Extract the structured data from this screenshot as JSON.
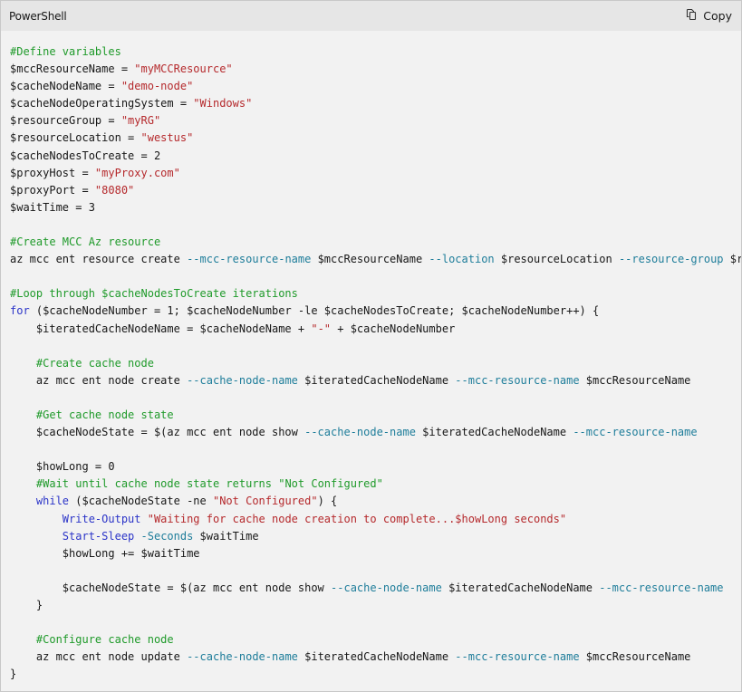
{
  "header": {
    "language": "PowerShell",
    "copy_label": "Copy",
    "copy_icon": "copy-icon"
  },
  "colors": {
    "comment": "#1f9a2a",
    "string": "#b5292c",
    "parameter": "#1e7d9a",
    "keyword": "#2b34c8",
    "text": "#171717",
    "background": "#f2f2f2",
    "header_background": "#e6e6e6"
  },
  "code": {
    "lines": [
      [
        {
          "t": "c",
          "v": "#Define variables"
        }
      ],
      [
        {
          "t": "n",
          "v": "$mccResourceName = "
        },
        {
          "t": "s",
          "v": "\"myMCCResource\""
        }
      ],
      [
        {
          "t": "n",
          "v": "$cacheNodeName = "
        },
        {
          "t": "s",
          "v": "\"demo-node\""
        }
      ],
      [
        {
          "t": "n",
          "v": "$cacheNodeOperatingSystem = "
        },
        {
          "t": "s",
          "v": "\"Windows\""
        }
      ],
      [
        {
          "t": "n",
          "v": "$resourceGroup = "
        },
        {
          "t": "s",
          "v": "\"myRG\""
        }
      ],
      [
        {
          "t": "n",
          "v": "$resourceLocation = "
        },
        {
          "t": "s",
          "v": "\"westus\""
        }
      ],
      [
        {
          "t": "n",
          "v": "$cacheNodesToCreate = 2"
        }
      ],
      [
        {
          "t": "n",
          "v": "$proxyHost = "
        },
        {
          "t": "s",
          "v": "\"myProxy.com\""
        }
      ],
      [
        {
          "t": "n",
          "v": "$proxyPort = "
        },
        {
          "t": "s",
          "v": "\"8080\""
        }
      ],
      [
        {
          "t": "n",
          "v": "$waitTime = 3"
        }
      ],
      [],
      [
        {
          "t": "c",
          "v": "#Create MCC Az resource"
        }
      ],
      [
        {
          "t": "n",
          "v": "az mcc ent resource create "
        },
        {
          "t": "p",
          "v": "--mcc-resource-name"
        },
        {
          "t": "n",
          "v": " $mccResourceName "
        },
        {
          "t": "p",
          "v": "--location"
        },
        {
          "t": "n",
          "v": " $resourceLocation "
        },
        {
          "t": "p",
          "v": "--resource-group"
        },
        {
          "t": "n",
          "v": " $resourceGroup"
        }
      ],
      [],
      [
        {
          "t": "c",
          "v": "#Loop through $cacheNodesToCreate iterations"
        }
      ],
      [
        {
          "t": "k",
          "v": "for"
        },
        {
          "t": "n",
          "v": " ($cacheNodeNumber = 1; $cacheNodeNumber -le $cacheNodesToCreate; $cacheNodeNumber++) {"
        }
      ],
      [
        {
          "t": "n",
          "v": "    $iteratedCacheNodeName = $cacheNodeName + "
        },
        {
          "t": "s",
          "v": "\"-\""
        },
        {
          "t": "n",
          "v": " + $cacheNodeNumber"
        }
      ],
      [],
      [
        {
          "t": "n",
          "v": "    "
        },
        {
          "t": "c",
          "v": "#Create cache node"
        }
      ],
      [
        {
          "t": "n",
          "v": "    az mcc ent node create "
        },
        {
          "t": "p",
          "v": "--cache-node-name"
        },
        {
          "t": "n",
          "v": " $iteratedCacheNodeName "
        },
        {
          "t": "p",
          "v": "--mcc-resource-name"
        },
        {
          "t": "n",
          "v": " $mccResourceName"
        }
      ],
      [],
      [
        {
          "t": "n",
          "v": "    "
        },
        {
          "t": "c",
          "v": "#Get cache node state"
        }
      ],
      [
        {
          "t": "n",
          "v": "    $cacheNodeState = $(az mcc ent node show "
        },
        {
          "t": "p",
          "v": "--cache-node-name"
        },
        {
          "t": "n",
          "v": " $iteratedCacheNodeName "
        },
        {
          "t": "p",
          "v": "--mcc-resource-name"
        }
      ],
      [],
      [
        {
          "t": "n",
          "v": "    $howLong = 0"
        }
      ],
      [
        {
          "t": "n",
          "v": "    "
        },
        {
          "t": "c",
          "v": "#Wait until cache node state returns \"Not Configured\""
        }
      ],
      [
        {
          "t": "n",
          "v": "    "
        },
        {
          "t": "k",
          "v": "while"
        },
        {
          "t": "n",
          "v": " ($cacheNodeState -ne "
        },
        {
          "t": "s",
          "v": "\"Not Configured\""
        },
        {
          "t": "n",
          "v": ") {"
        }
      ],
      [
        {
          "t": "n",
          "v": "        "
        },
        {
          "t": "k",
          "v": "Write-Output"
        },
        {
          "t": "n",
          "v": " "
        },
        {
          "t": "s",
          "v": "\"Waiting for cache node creation to complete...$howLong seconds\""
        }
      ],
      [
        {
          "t": "n",
          "v": "        "
        },
        {
          "t": "k",
          "v": "Start-Sleep"
        },
        {
          "t": "n",
          "v": " "
        },
        {
          "t": "p",
          "v": "-Seconds"
        },
        {
          "t": "n",
          "v": " $waitTime"
        }
      ],
      [
        {
          "t": "n",
          "v": "        $howLong += $waitTime"
        }
      ],
      [],
      [
        {
          "t": "n",
          "v": "        $cacheNodeState = $(az mcc ent node show "
        },
        {
          "t": "p",
          "v": "--cache-node-name"
        },
        {
          "t": "n",
          "v": " $iteratedCacheNodeName "
        },
        {
          "t": "p",
          "v": "--mcc-resource-name"
        }
      ],
      [
        {
          "t": "n",
          "v": "    }"
        }
      ],
      [],
      [
        {
          "t": "n",
          "v": "    "
        },
        {
          "t": "c",
          "v": "#Configure cache node"
        }
      ],
      [
        {
          "t": "n",
          "v": "    az mcc ent node update "
        },
        {
          "t": "p",
          "v": "--cache-node-name"
        },
        {
          "t": "n",
          "v": " $iteratedCacheNodeName "
        },
        {
          "t": "p",
          "v": "--mcc-resource-name"
        },
        {
          "t": "n",
          "v": " $mccResourceName"
        }
      ],
      [
        {
          "t": "n",
          "v": "}"
        }
      ]
    ]
  }
}
